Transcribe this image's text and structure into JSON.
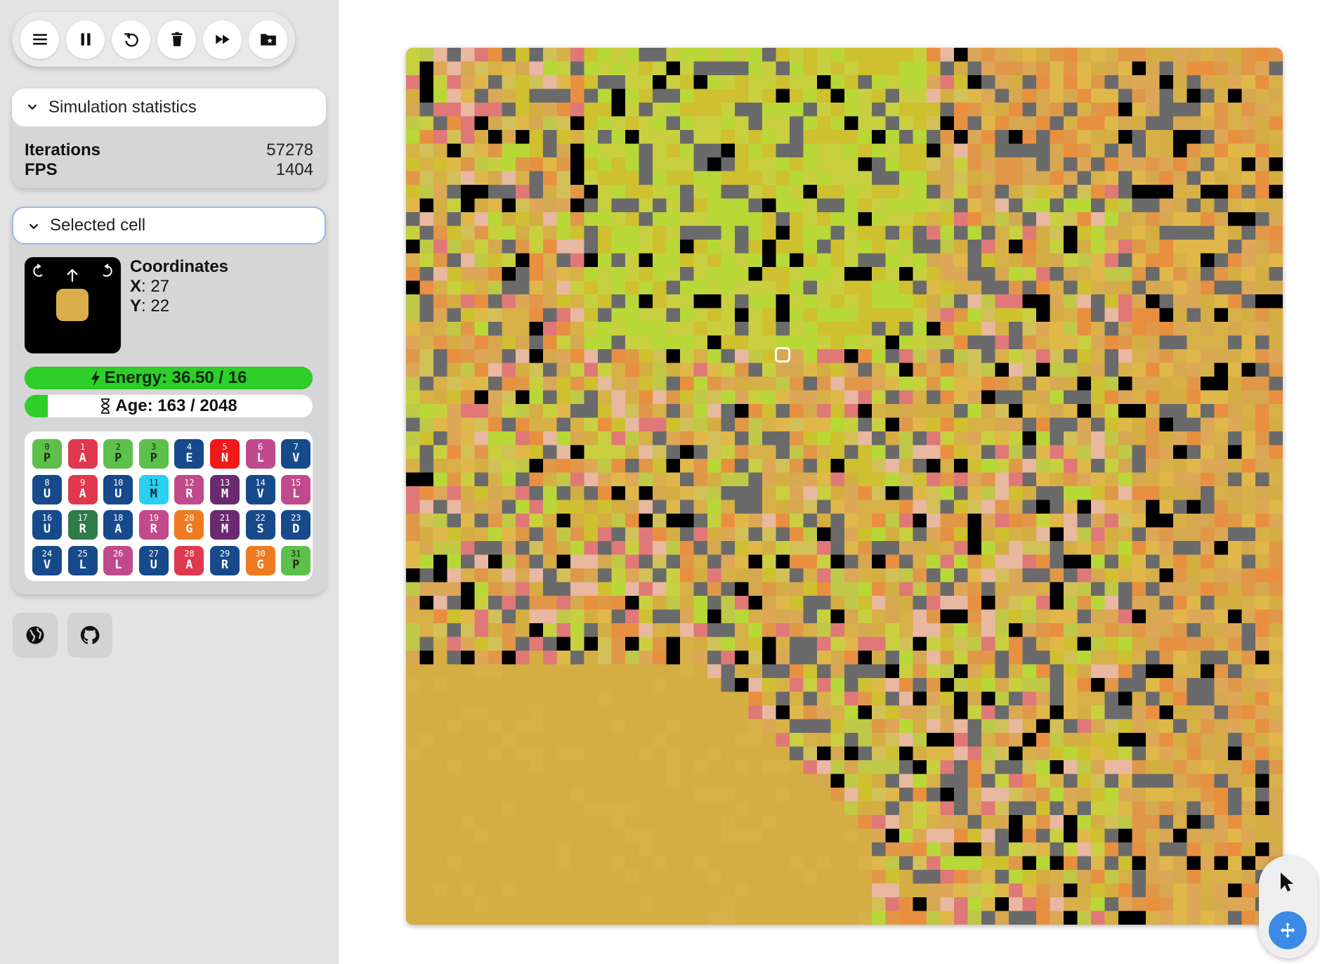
{
  "toolbar": {
    "buttons": [
      {
        "name": "menu-button",
        "icon": "hamburger-icon"
      },
      {
        "name": "pause-button",
        "icon": "pause-icon"
      },
      {
        "name": "restart-button",
        "icon": "restart-icon"
      },
      {
        "name": "delete-button",
        "icon": "trash-icon"
      },
      {
        "name": "fast-forward-button",
        "icon": "fast-forward-icon"
      },
      {
        "name": "saved-worlds-button",
        "icon": "folder-star-icon"
      }
    ]
  },
  "stats": {
    "title": "Simulation statistics",
    "iterations_label": "Iterations",
    "iterations_value": "57278",
    "fps_label": "FPS",
    "fps_value": "1404"
  },
  "selected": {
    "title": "Selected cell",
    "coords_title": "Coordinates",
    "x_label": "X",
    "x_value": ": 27",
    "y_label": "Y",
    "y_value": ": 22",
    "cell_color": "#d9ae4a",
    "energy_text": "Energy: 36.50 / 16",
    "age_text": "Age: 163 / 2048",
    "age_fraction": 0.08
  },
  "genome": [
    {
      "n": "0",
      "c": "P",
      "color": "#5cc04a",
      "fg": "#1a2a10"
    },
    {
      "n": "1",
      "c": "A",
      "color": "#e0384e",
      "fg": "#ffffff"
    },
    {
      "n": "2",
      "c": "P",
      "color": "#5cc04a",
      "fg": "#1a2a10"
    },
    {
      "n": "3",
      "c": "P",
      "color": "#5cc04a",
      "fg": "#1a2a10"
    },
    {
      "n": "4",
      "c": "E",
      "color": "#164a8a",
      "fg": "#ffffff"
    },
    {
      "n": "5",
      "c": "N",
      "color": "#f01818",
      "fg": "#ffffff"
    },
    {
      "n": "6",
      "c": "L",
      "color": "#c04a8c",
      "fg": "#ffffff"
    },
    {
      "n": "7",
      "c": "V",
      "color": "#164a8a",
      "fg": "#ffffff"
    },
    {
      "n": "8",
      "c": "U",
      "color": "#164a8a",
      "fg": "#ffffff"
    },
    {
      "n": "9",
      "c": "A",
      "color": "#e0384e",
      "fg": "#ffffff"
    },
    {
      "n": "10",
      "c": "U",
      "color": "#164a8a",
      "fg": "#ffffff"
    },
    {
      "n": "11",
      "c": "M",
      "color": "#2ad0f0",
      "fg": "#102830"
    },
    {
      "n": "12",
      "c": "R",
      "color": "#c04a8c",
      "fg": "#ffffff"
    },
    {
      "n": "13",
      "c": "M",
      "color": "#6a2a70",
      "fg": "#ffffff"
    },
    {
      "n": "14",
      "c": "V",
      "color": "#164a8a",
      "fg": "#ffffff"
    },
    {
      "n": "15",
      "c": "L",
      "color": "#c04a8c",
      "fg": "#ffffff"
    },
    {
      "n": "16",
      "c": "U",
      "color": "#164a8a",
      "fg": "#ffffff"
    },
    {
      "n": "17",
      "c": "R",
      "color": "#2e7a48",
      "fg": "#ffffff"
    },
    {
      "n": "18",
      "c": "A",
      "color": "#164a8a",
      "fg": "#ffffff"
    },
    {
      "n": "19",
      "c": "R",
      "color": "#c04a8c",
      "fg": "#ffffff"
    },
    {
      "n": "20",
      "c": "G",
      "color": "#f07a20",
      "fg": "#ffffff"
    },
    {
      "n": "21",
      "c": "M",
      "color": "#6a2a70",
      "fg": "#ffffff"
    },
    {
      "n": "22",
      "c": "S",
      "color": "#164a8a",
      "fg": "#ffffff"
    },
    {
      "n": "23",
      "c": "D",
      "color": "#164a8a",
      "fg": "#ffffff"
    },
    {
      "n": "24",
      "c": "V",
      "color": "#164a8a",
      "fg": "#ffffff"
    },
    {
      "n": "25",
      "c": "L",
      "color": "#164a8a",
      "fg": "#ffffff"
    },
    {
      "n": "26",
      "c": "L",
      "color": "#c04a8c",
      "fg": "#ffffff"
    },
    {
      "n": "27",
      "c": "U",
      "color": "#164a8a",
      "fg": "#ffffff"
    },
    {
      "n": "28",
      "c": "A",
      "color": "#e0384e",
      "fg": "#ffffff"
    },
    {
      "n": "29",
      "c": "R",
      "color": "#164a8a",
      "fg": "#ffffff"
    },
    {
      "n": "30",
      "c": "G",
      "color": "#f07a20",
      "fg": "#ffffff"
    },
    {
      "n": "31",
      "c": "P",
      "color": "#5cc04a",
      "fg": "#1a2a10"
    }
  ],
  "links": [
    {
      "name": "website-link",
      "icon": "globe-icon"
    },
    {
      "name": "github-link",
      "icon": "github-icon"
    }
  ],
  "world": {
    "grid_size": 64,
    "palette": {
      "empty": "#6a6a6a",
      "void": "#000000",
      "cells": [
        "#d4ae42",
        "#d8b048",
        "#e0b84a",
        "#cfc030",
        "#c8d040",
        "#b8d838",
        "#d6a850",
        "#dca858",
        "#e09848",
        "#e8b8a0",
        "#e07878",
        "#e89040",
        "#d2c058",
        "#c0c848"
      ]
    }
  },
  "tools": {
    "pointer_icon": "cursor-icon",
    "move_icon": "move-icon"
  }
}
